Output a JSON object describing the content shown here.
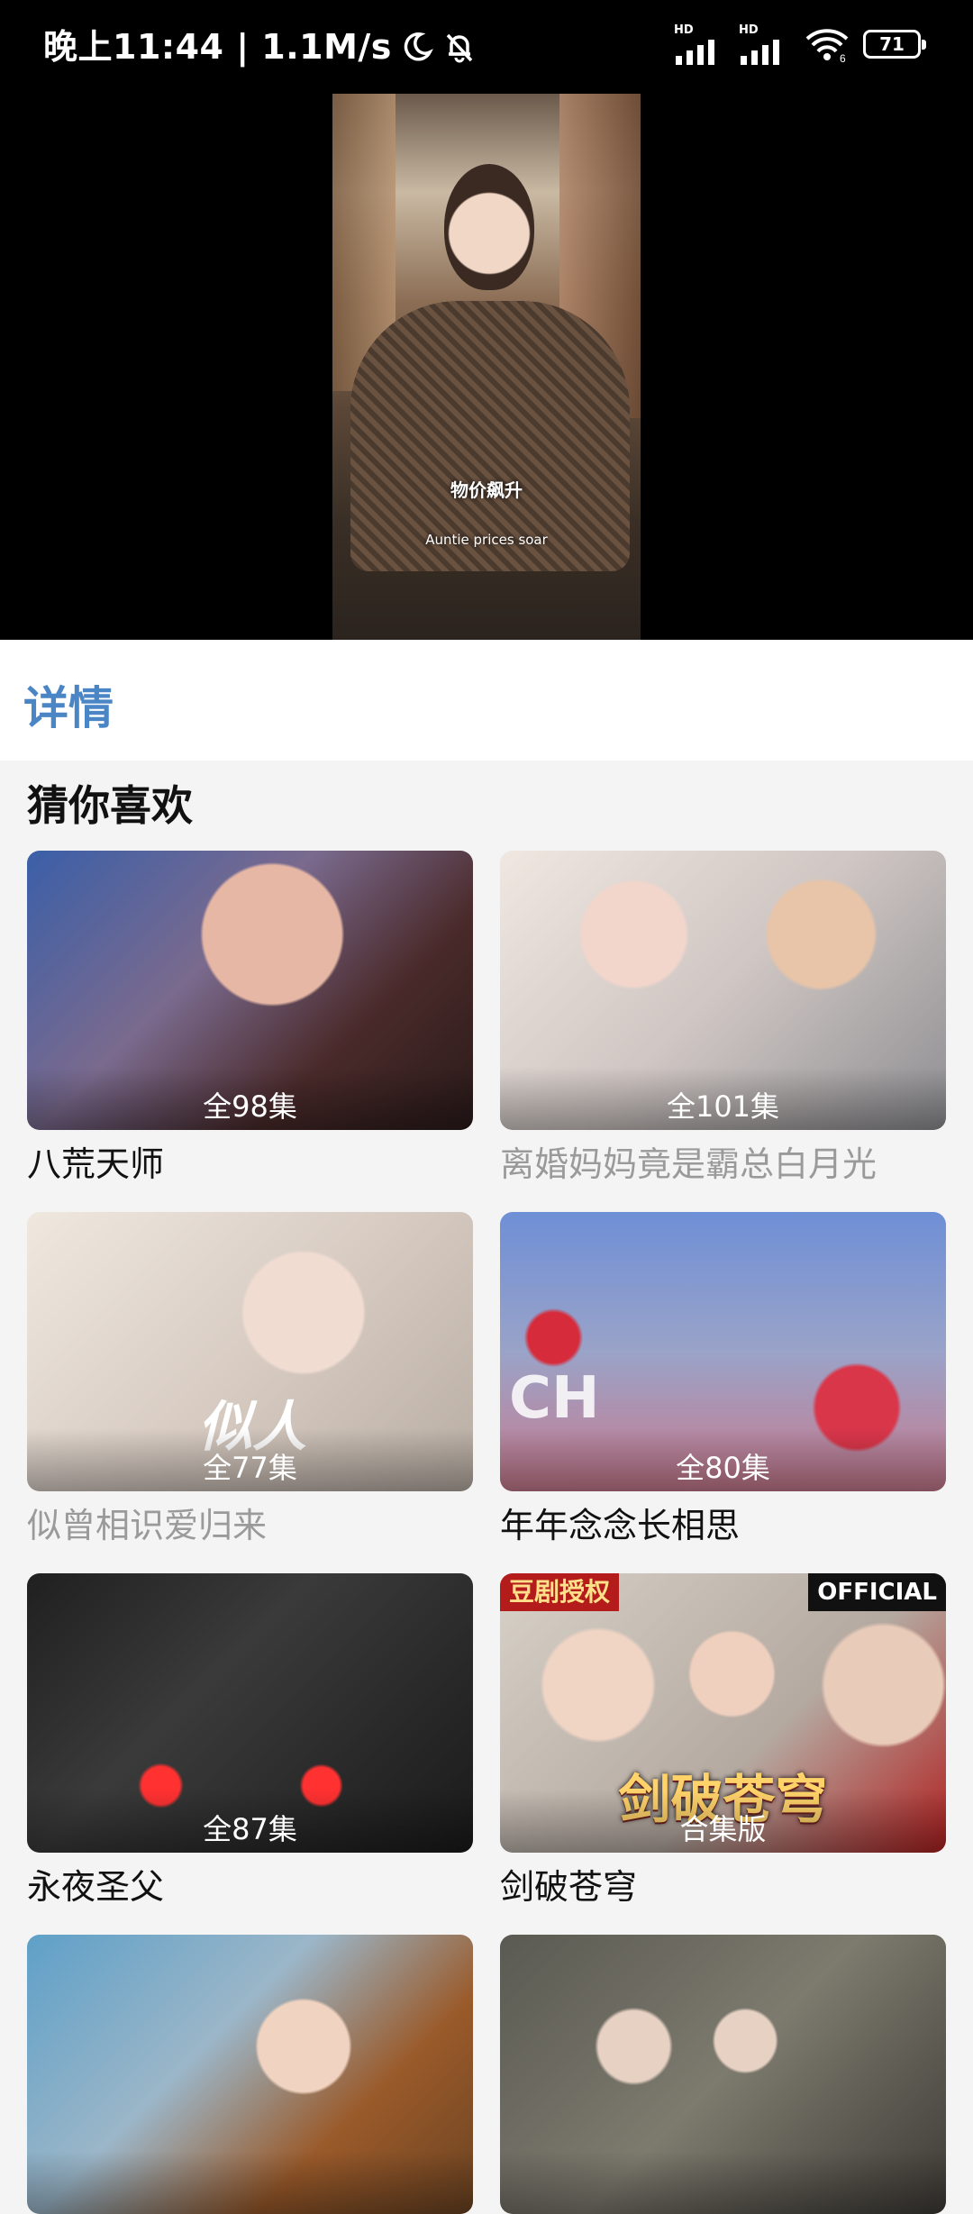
{
  "status_bar": {
    "time": "晚上11:44 | 1.1M/s",
    "hd1": "HD",
    "hd2": "HD",
    "wifi_tag": "6",
    "battery": "71"
  },
  "video": {
    "subtitle_cn": "物价飙升",
    "subtitle_en": "Auntie prices soar"
  },
  "tabs": {
    "details": "详情"
  },
  "recommend": {
    "title": "猜你喜欢",
    "items": [
      {
        "episodes": "全98集",
        "title": "八荒天师"
      },
      {
        "episodes": "全101集",
        "title": "离婚妈妈竟是霸总白月光"
      },
      {
        "episodes": "全77集",
        "title": "似曾相识爱归来"
      },
      {
        "episodes": "全80集",
        "title": "年年念念长相思"
      },
      {
        "episodes": "全87集",
        "title": "永夜圣父"
      },
      {
        "episodes": "合集版",
        "title": "剑破苍穹"
      },
      {
        "episodes": "",
        "title": ""
      },
      {
        "episodes": "",
        "title": ""
      }
    ],
    "poster_text": {
      "item3_calligraphy": "似人",
      "item4_letters": "CH",
      "item6_badge": "豆剧授权",
      "item6_official": "OFFICIAL",
      "item6_title": "剑破苍穹"
    }
  }
}
